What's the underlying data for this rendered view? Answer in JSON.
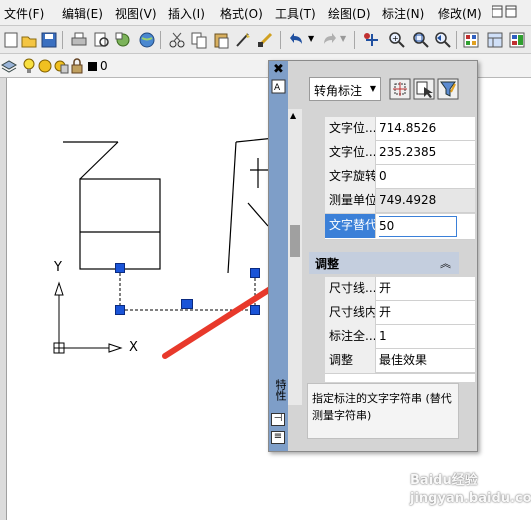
{
  "menu": {
    "items": [
      "文件(F)",
      "编辑(E)",
      "视图(V)",
      "插入(I)",
      "格式(O)",
      "工具(T)",
      "绘图(D)",
      "标注(N)",
      "修改(M)"
    ]
  },
  "layer_bar": {
    "current_layer": "0"
  },
  "canvas": {
    "ucs_x_label": "X",
    "ucs_y_label": "Y"
  },
  "properties": {
    "object_type": "转角标注",
    "side_label": "特性",
    "section_name": "调整",
    "rows_text": [
      {
        "label": "文字位...",
        "value": "714.8526"
      },
      {
        "label": "文字位...",
        "value": "235.2385"
      },
      {
        "label": "文字旋转",
        "value": "0"
      },
      {
        "label": "测量单位",
        "value": "749.4928"
      },
      {
        "label": "文字替代",
        "value": "50"
      }
    ],
    "rows_fit": [
      {
        "label": "尺寸线...",
        "value": "开"
      },
      {
        "label": "尺寸线内",
        "value": "开"
      },
      {
        "label": "标注全...",
        "value": "1"
      },
      {
        "label": "调整",
        "value": "最佳效果"
      }
    ],
    "description": "指定标注的文字字符串 (替代测量字符串)"
  },
  "watermark": "Baidu经验 jingyan.baidu.com",
  "colors": {
    "selected_row": "#3b80d8",
    "grip": "#1a54d8",
    "arrow": "#e8392b"
  }
}
